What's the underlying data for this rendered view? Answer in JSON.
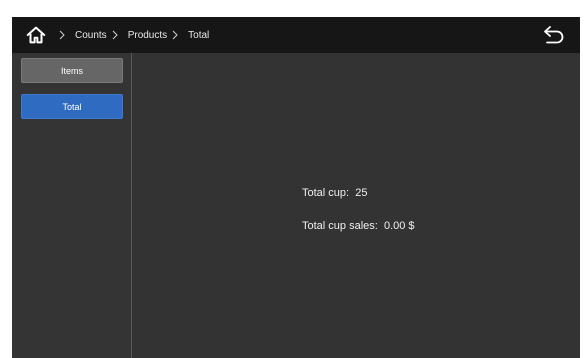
{
  "topbar": {
    "home_icon": "home-icon",
    "breadcrumb": [
      "Counts",
      "Products",
      "Total"
    ],
    "back_icon": "undo-arrow-icon"
  },
  "sidebar": {
    "items": [
      {
        "label": "Items",
        "selected": false
      },
      {
        "label": "Total",
        "selected": true
      }
    ],
    "selected_color": "#2f6bc0"
  },
  "main": {
    "total_cup_label": "Total cup:",
    "total_cup_value": "25",
    "total_cup_sales_label": "Total cup sales:",
    "total_cup_sales_value": "0.00 $"
  },
  "colors": {
    "background": "#333333",
    "topbar": "#161616",
    "text": "#f0f0f0"
  }
}
